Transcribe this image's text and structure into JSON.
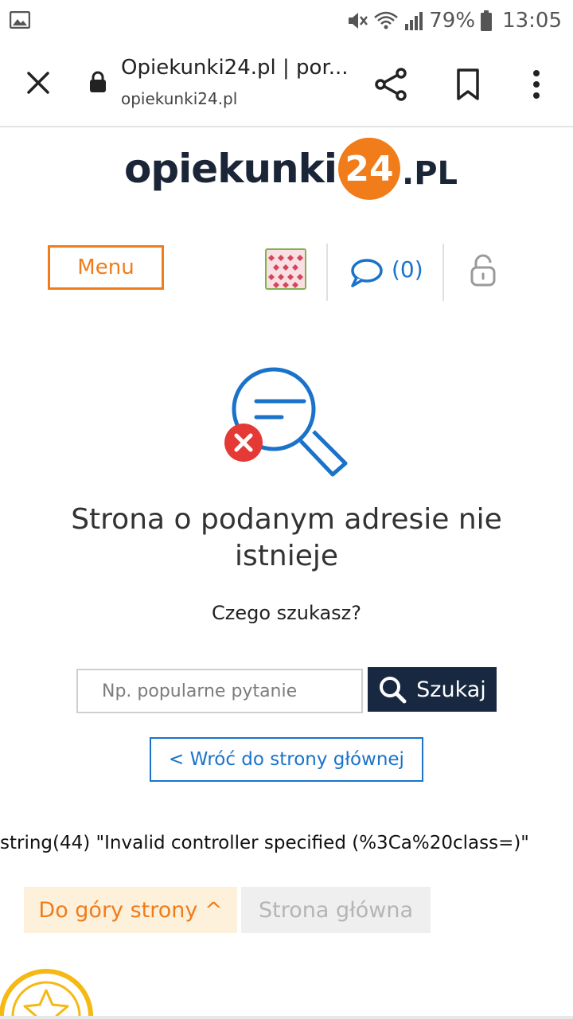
{
  "status_bar": {
    "battery_percent": "79%",
    "time": "13:05",
    "icons": [
      "gallery-icon",
      "mute-icon",
      "wifi-icon",
      "signal-icon",
      "battery-icon"
    ]
  },
  "browser": {
    "title": "Opiekunki24.pl | por...",
    "url": "opiekunki24.pl",
    "icons": [
      "close-icon",
      "lock-icon",
      "share-icon",
      "bookmark-icon",
      "more-icon"
    ]
  },
  "logo": {
    "word": "opiekunki",
    "number": "24",
    "suffix": ".PL"
  },
  "nav": {
    "menu_label": "Menu",
    "messages_count": "(0)"
  },
  "page": {
    "heading_line1": "Strona o podanym adresie nie",
    "heading_line2": "istnieje",
    "subheading": "Czego szukasz?",
    "search_placeholder": "Np. popularne pytanie",
    "search_value": "",
    "search_button": "Szukaj",
    "back_link": "< Wróć do strony głównej",
    "debug_text": "string(44) \"Invalid controller specified (%3Ca%20class=)\"",
    "top_button": "Do góry strony ^",
    "home_button": "Strona główna"
  },
  "colors": {
    "brand_orange": "#f07c1a",
    "brand_navy": "#172840",
    "link_blue": "#1a73c9",
    "error_red": "#e53935"
  }
}
